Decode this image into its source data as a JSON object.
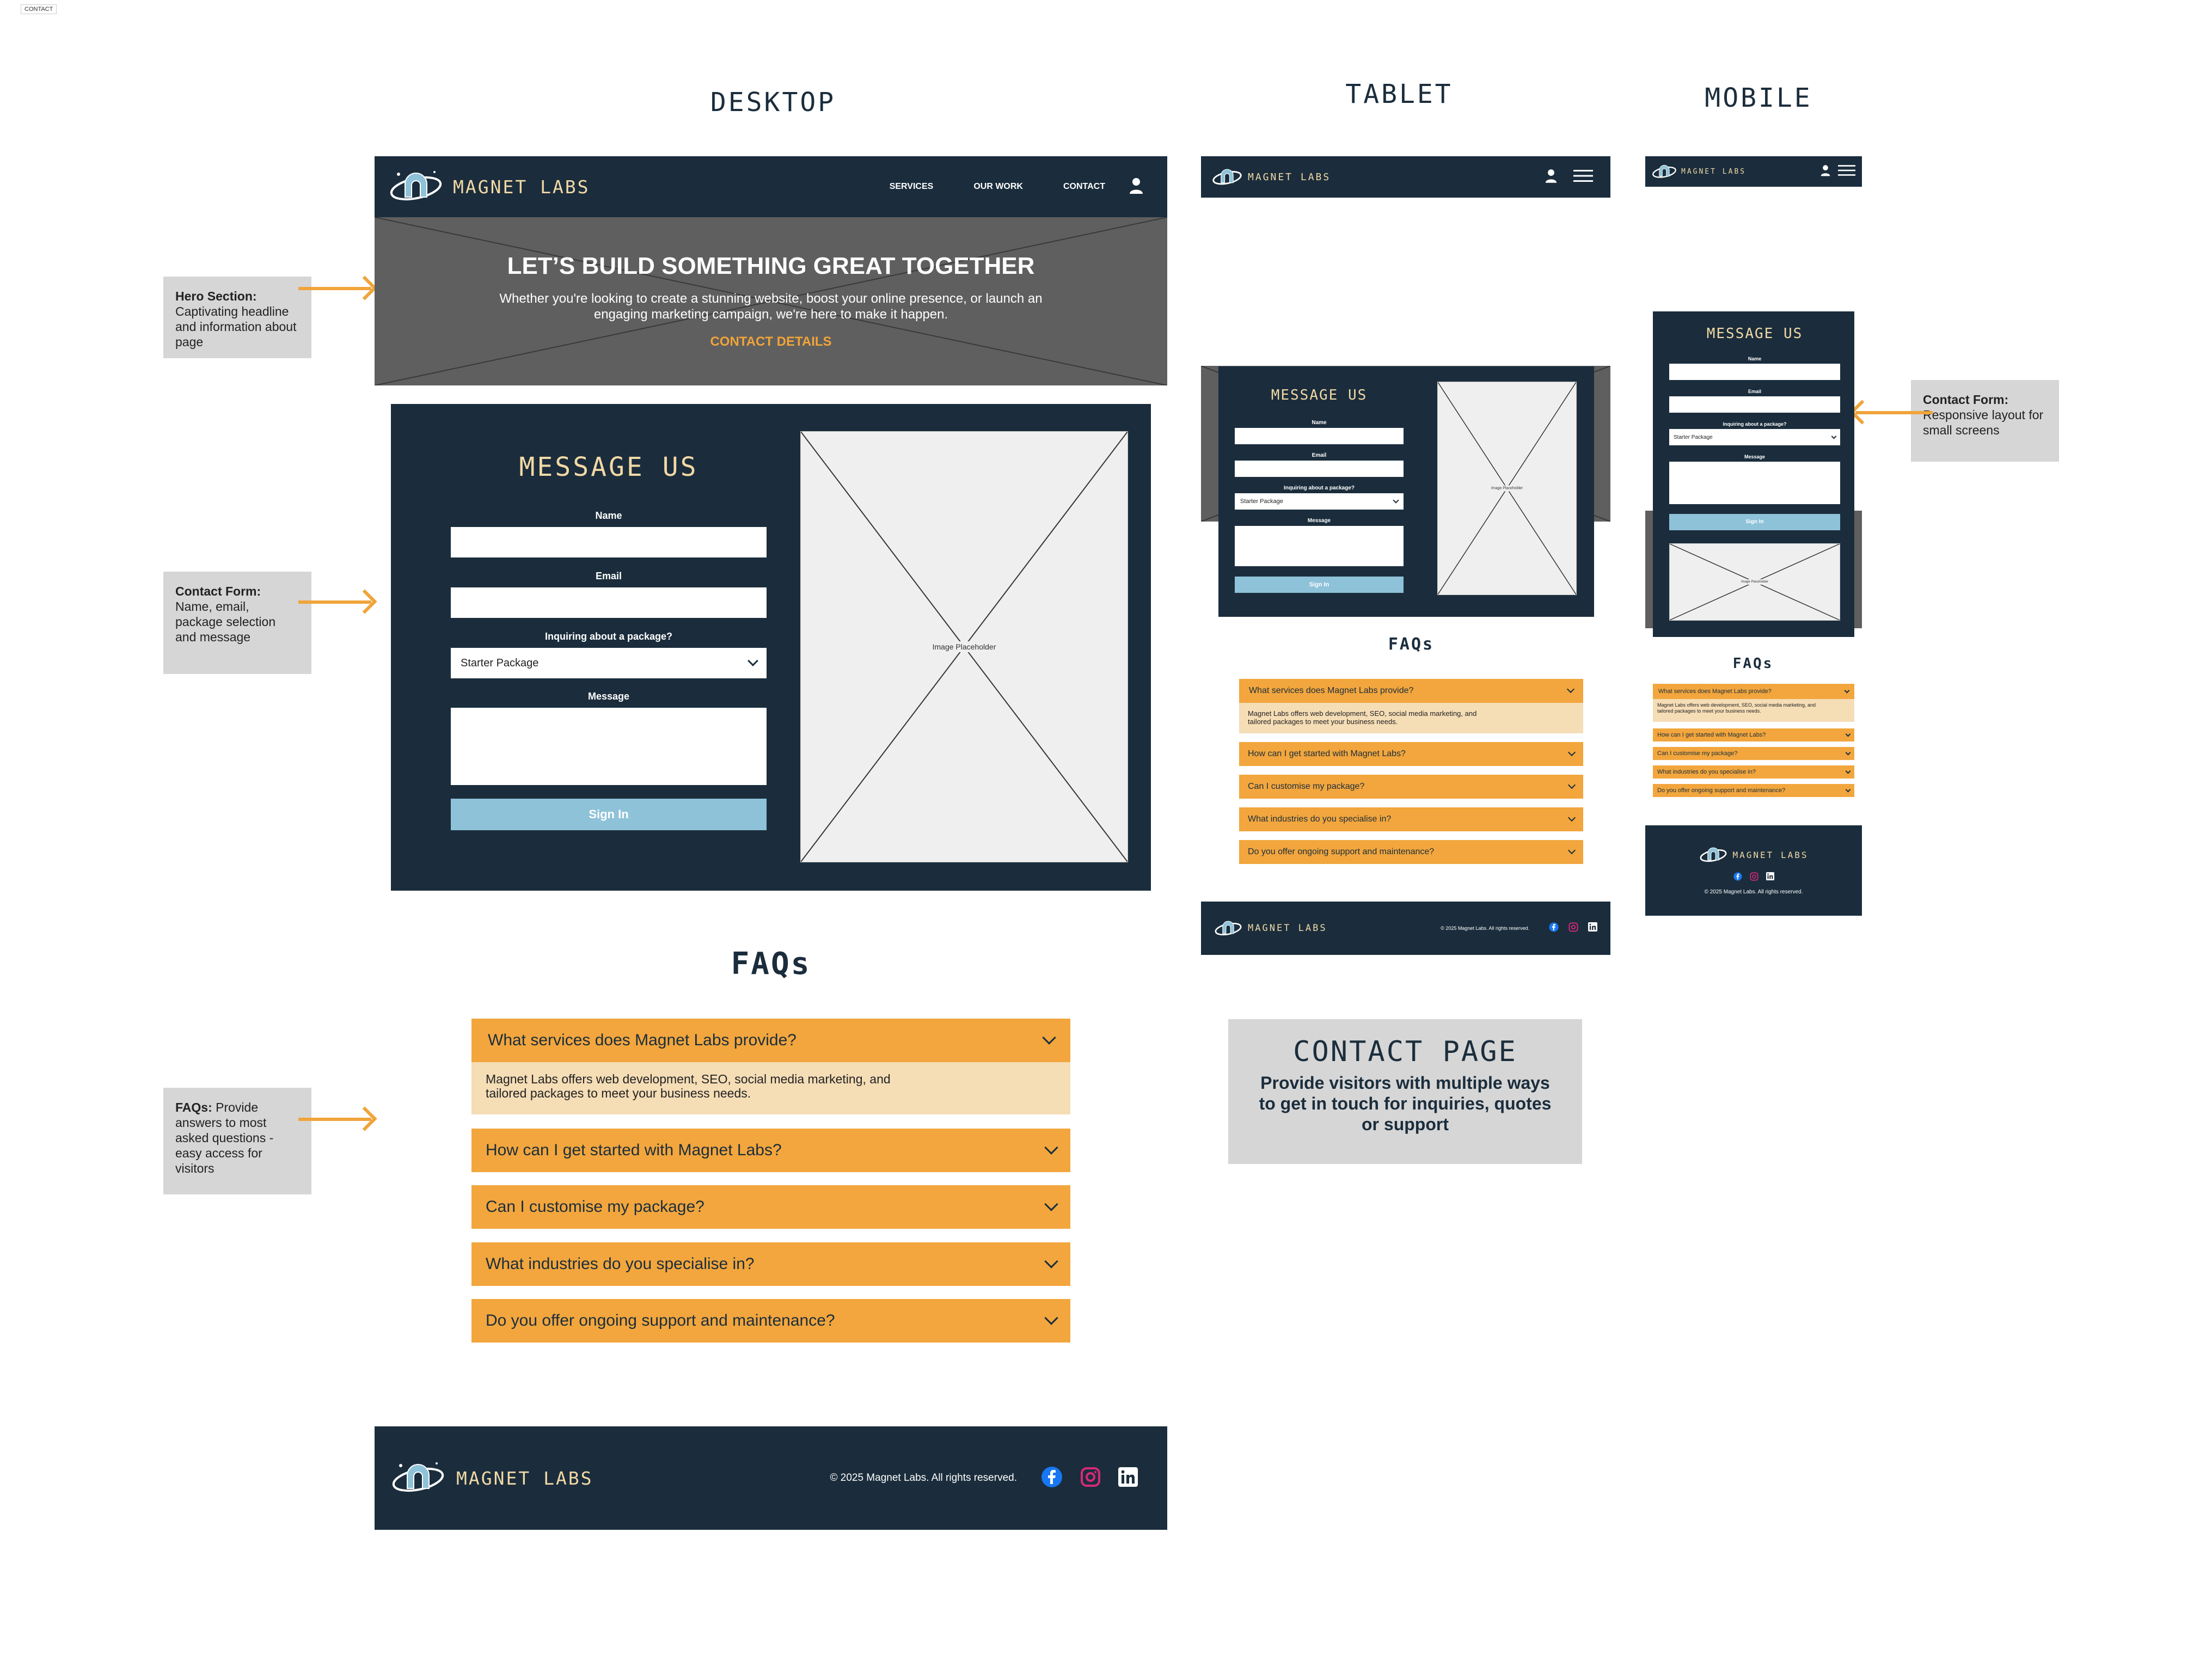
{
  "frame_label": "CONTACT",
  "views": {
    "desktop": "DESKTOP",
    "tablet": "TABLET",
    "mobile": "MOBILE"
  },
  "notes": {
    "hero": {
      "title": "Hero Section:",
      "text": "Captivating headline and information about page"
    },
    "contact_form": {
      "title": "Contact Form:",
      "text": "Name, email, package selection and message"
    },
    "faqs": {
      "title": "FAQs:",
      "text": "Provide answers to most asked questions - easy access for visitors"
    },
    "contact_form_mobile": {
      "title": "Contact Form:",
      "text": "Responsive layout for small screens"
    }
  },
  "brand": "MAGNET LABS",
  "nav": {
    "services": "SERVICES",
    "our_work": "OUR WORK",
    "contact": "CONTACT"
  },
  "hero": {
    "headline": "LET’S BUILD SOMETHING GREAT TOGETHER",
    "subtext": "Whether you're looking to create a stunning website, boost your online presence, or launch an engaging marketing campaign, we're here to make it happen.",
    "cta": "CONTACT DETAILS"
  },
  "form": {
    "title": "MESSAGE US",
    "name_label": "Name",
    "email_label": "Email",
    "package_label": "Inquiring about a package?",
    "package_value": "Starter Package",
    "message_label": "Message",
    "submit": "Sign In",
    "image_placeholder": "Image Placeholder"
  },
  "faqs": {
    "title": "FAQs",
    "items": [
      {
        "q": "What services does Magnet Labs provide?",
        "a": "Magnet Labs offers web development, SEO, social media marketing, and tailored packages to meet your business needs."
      },
      {
        "q": "How can I get started with Magnet Labs?"
      },
      {
        "q": "Can I customise my package?"
      },
      {
        "q": "What industries do you specialise in?"
      },
      {
        "q": "Do you offer ongoing support and maintenance?"
      }
    ]
  },
  "footer": {
    "copyright": "© 2025 Magnet Labs. All rights reserved."
  },
  "summary": {
    "title": "CONTACT PAGE",
    "text": "Provide visitors with multiple ways to get in touch for inquiries, quotes or support"
  },
  "colors": {
    "navy": "#1b2d3c",
    "orange": "#f2a63d",
    "light_orange": "#f5ddb6",
    "hero_grey": "#5f5f5f",
    "submit_blue": "#8ec2d9",
    "brand_cream": "#f2d9a6",
    "facebook": "#1877f2",
    "instagram": "#d62976"
  },
  "icons": [
    "magnet-logo-icon",
    "user-icon",
    "hamburger-icon",
    "chevron-down-icon",
    "facebook-icon",
    "instagram-icon",
    "linkedin-icon",
    "arrow-icon"
  ]
}
